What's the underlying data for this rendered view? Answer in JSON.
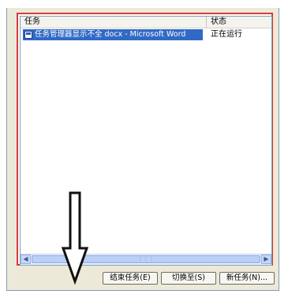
{
  "columns": {
    "task": "任务",
    "status": "状态"
  },
  "rows": [
    {
      "task": "任务管理器显示不全 docx - Microsoft Word",
      "status": "正在运行"
    }
  ],
  "buttons": {
    "end_task": "结束任务(E)",
    "switch_to": "切换至(S)",
    "new_task": "新任务(N)..."
  },
  "colors": {
    "highlight_box": "#d63a3a",
    "selection": "#316ac5"
  },
  "icons": {
    "row_icon": "word-doc-icon",
    "arrow": "down-arrow-annotation-icon"
  }
}
